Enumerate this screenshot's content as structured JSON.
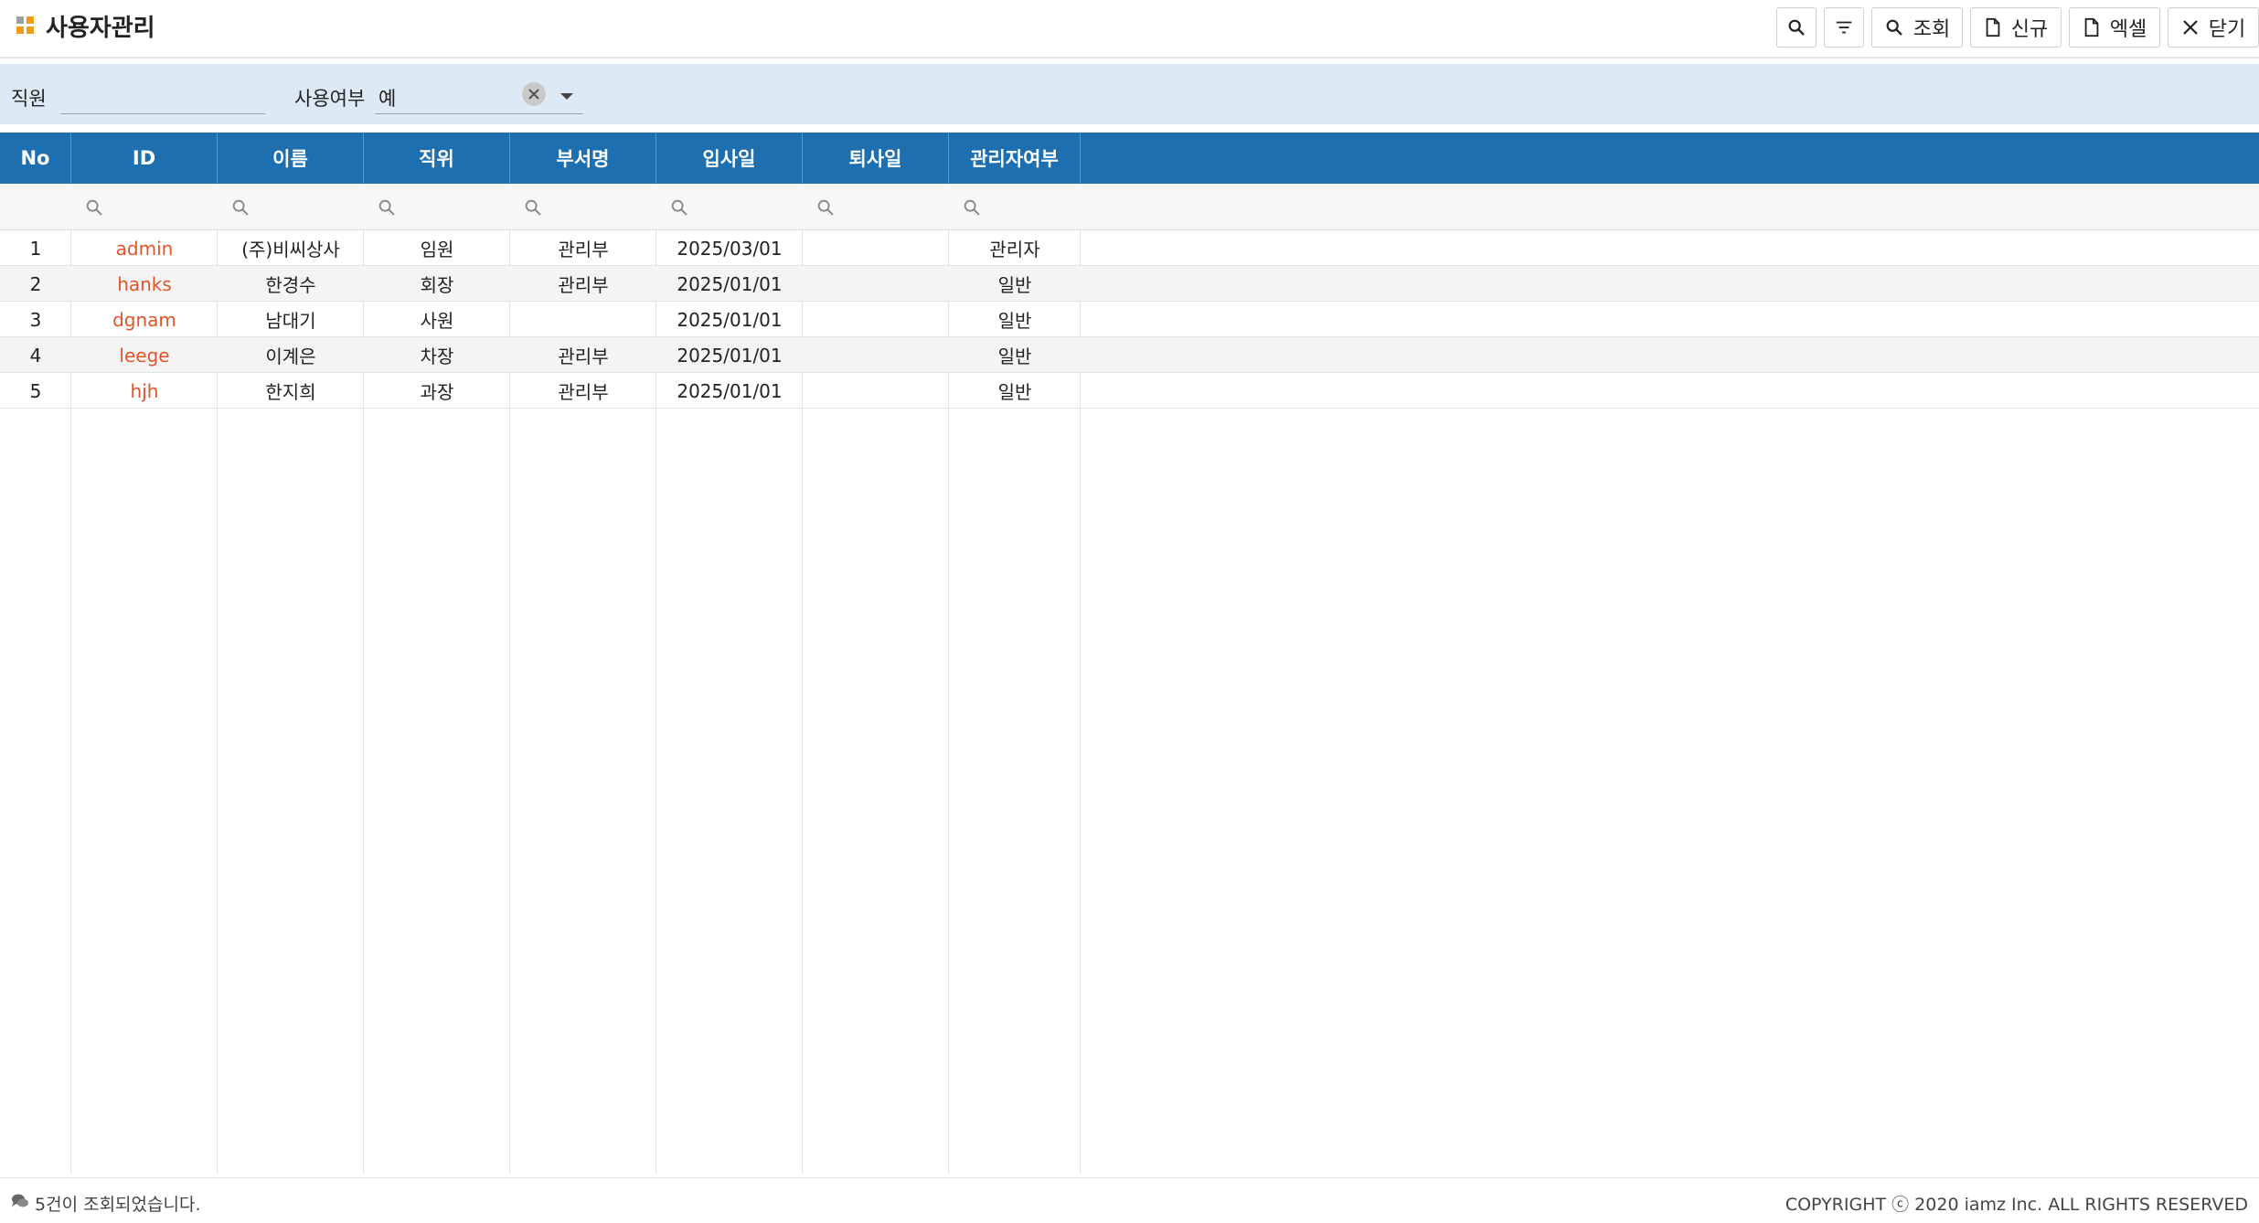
{
  "header": {
    "title": "사용자관리",
    "title_icon": "grid-dots-icon",
    "buttons": {
      "search_icon_button": "search-icon",
      "filter_icon_button": "filter-icon",
      "inquire_label": "조회",
      "new_label": "신규",
      "excel_label": "엑셀",
      "close_label": "닫기"
    }
  },
  "search_panel": {
    "employee_label": "직원",
    "employee_value": "",
    "use_label": "사용여부",
    "use_value": "예"
  },
  "grid": {
    "columns": [
      "No",
      "ID",
      "이름",
      "직위",
      "부서명",
      "입사일",
      "퇴사일",
      "관리자여부"
    ],
    "rows": [
      {
        "no": "1",
        "id": "admin",
        "name": "(주)비씨상사",
        "position": "임원",
        "dept": "관리부",
        "hire_date": "2025/03/01",
        "leave_date": "",
        "admin": "관리자"
      },
      {
        "no": "2",
        "id": "hanks",
        "name": "한경수",
        "position": "회장",
        "dept": "관리부",
        "hire_date": "2025/01/01",
        "leave_date": "",
        "admin": "일반"
      },
      {
        "no": "3",
        "id": "dgnam",
        "name": "남대기",
        "position": "사원",
        "dept": "",
        "hire_date": "2025/01/01",
        "leave_date": "",
        "admin": "일반"
      },
      {
        "no": "4",
        "id": "leege",
        "name": "이계은",
        "position": "차장",
        "dept": "관리부",
        "hire_date": "2025/01/01",
        "leave_date": "",
        "admin": "일반"
      },
      {
        "no": "5",
        "id": "hjh",
        "name": "한지희",
        "position": "과장",
        "dept": "관리부",
        "hire_date": "2025/01/01",
        "leave_date": "",
        "admin": "일반"
      }
    ]
  },
  "footer": {
    "message": "5건이 조회되었습니다.",
    "copyright": "COPYRIGHT ⓒ 2020 iamz Inc. ALL RIGHTS RESERVED"
  },
  "colors": {
    "header_blue": "#1e6fb0",
    "search_panel_bg": "#dde9f5",
    "id_link": "#e2542a",
    "title_icon_orange": "#f39c12",
    "title_icon_gray": "#9e9e9e"
  }
}
